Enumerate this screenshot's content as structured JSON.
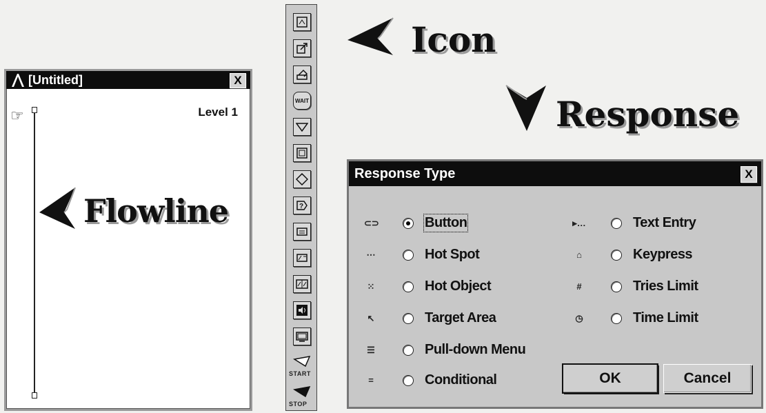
{
  "flowline_window": {
    "title": "[Untitled]",
    "close_label": "X",
    "level": "Level 1"
  },
  "labels": {
    "flowline": "Flowline",
    "icon": "Icon",
    "response": "Response"
  },
  "palette": {
    "icons": [
      "display-icon",
      "animation-icon",
      "erase-icon",
      "wait-icon",
      "decision-icon",
      "interaction-icon",
      "calculation-icon",
      "map-icon",
      "navigate-icon",
      "framework-icon",
      "digital-movie-icon",
      "sound-icon",
      "video-icon"
    ],
    "wait_text": "WAIT",
    "start_label": "START",
    "stop_label": "STOP"
  },
  "dialog": {
    "title": "Response Type",
    "close_label": "X",
    "left_options": [
      {
        "label": "Button",
        "selected": true
      },
      {
        "label": "Hot Spot",
        "selected": false
      },
      {
        "label": "Hot Object",
        "selected": false
      },
      {
        "label": "Target Area",
        "selected": false
      },
      {
        "label": "Pull-down Menu",
        "selected": false
      },
      {
        "label": "Conditional",
        "selected": false
      }
    ],
    "right_options": [
      {
        "label": "Text Entry",
        "selected": false
      },
      {
        "label": "Keypress",
        "selected": false
      },
      {
        "label": "Tries Limit",
        "selected": false
      },
      {
        "label": "Time Limit",
        "selected": false
      }
    ],
    "ok_label": "OK",
    "cancel_label": "Cancel"
  }
}
